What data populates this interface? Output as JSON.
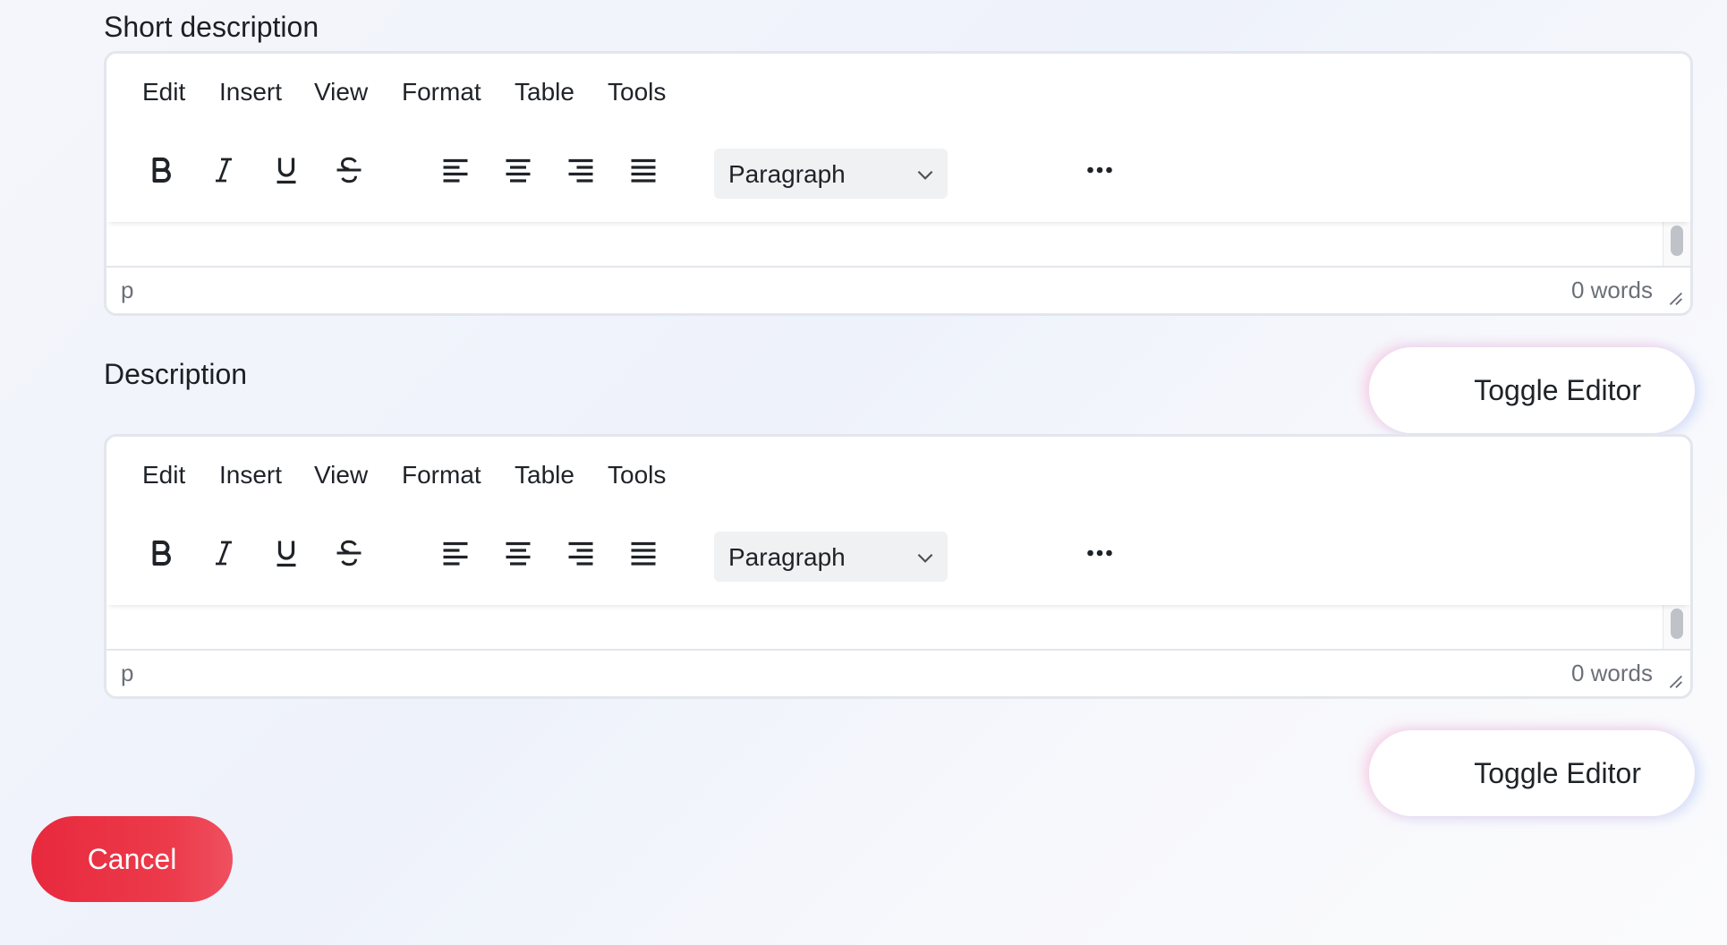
{
  "fields": [
    {
      "label": "Short description",
      "menu": [
        "Edit",
        "Insert",
        "View",
        "Format",
        "Table",
        "Tools"
      ],
      "block_format": "Paragraph",
      "path": "p",
      "word_count": "0 words"
    },
    {
      "label": "Description",
      "menu": [
        "Edit",
        "Insert",
        "View",
        "Format",
        "Table",
        "Tools"
      ],
      "block_format": "Paragraph",
      "path": "p",
      "word_count": "0 words",
      "toggle_label": "Toggle Editor"
    }
  ],
  "after_description": {
    "toggle_label": "Toggle Editor"
  },
  "footer": {
    "cancel_label": "Cancel"
  },
  "toolbar_icons": [
    "bold-icon",
    "italic-icon",
    "underline-icon",
    "strikethrough-icon",
    "align-left-icon",
    "align-center-icon",
    "align-right-icon",
    "justify-icon",
    "more-icon"
  ],
  "colors": {
    "cancel": "#e8293e",
    "border": "#e3e6ec"
  }
}
